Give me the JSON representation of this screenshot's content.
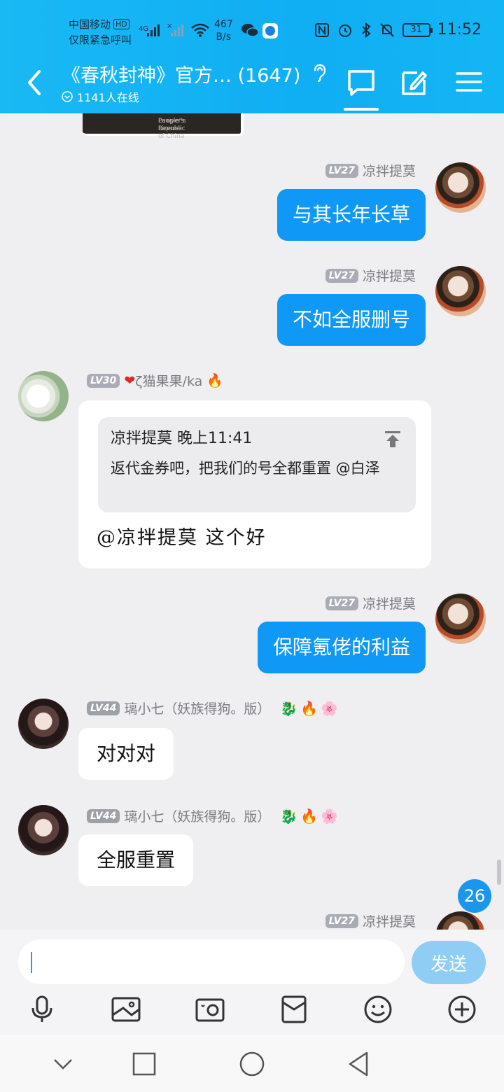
{
  "status_bar": {
    "carrier_line1": "中国移动",
    "hd_badge": "HD",
    "carrier_line2": "仅限紧急呼叫",
    "net_speed_value": "467",
    "net_speed_unit": "B/s",
    "battery": "31",
    "time": "11:52"
  },
  "header": {
    "title": "《春秋封神》官方… (1647)",
    "online_text": "1141人在线"
  },
  "shared_image_caption": {
    "line1": "Lawyer's License",
    "line2": "People's Republic of China"
  },
  "messages": [
    {
      "sender": "凉拌提莫",
      "level": "LV27",
      "text": "与其长年长草"
    },
    {
      "sender": "凉拌提莫",
      "level": "LV27",
      "text": "不如全服删号"
    },
    {
      "sender": "ζ猫果果/ka",
      "level": "LV30",
      "quote_header": "凉拌提莫 晚上11:41",
      "quote_text": "返代金券吧，把我们的号全都重置 @白泽",
      "text": "@凉拌提莫 这个好"
    },
    {
      "sender": "凉拌提莫",
      "level": "LV27",
      "text": "保障氪佬的利益"
    },
    {
      "sender": "璃小七（妖族得狗。版）",
      "level": "LV44",
      "text": "对对对"
    },
    {
      "sender": "璃小七（妖族得狗。版）",
      "level": "LV44",
      "text": "全服重置"
    },
    {
      "sender": "凉拌提莫",
      "level": "LV27"
    }
  ],
  "unread_count": "26",
  "input": {
    "placeholder": "",
    "send_label": "发送"
  },
  "icons": [
    "back-icon",
    "ear-icon",
    "chat-icon",
    "edit-icon",
    "menu-icon",
    "mic-icon",
    "picture-icon",
    "camera-icon",
    "red-packet-icon",
    "emoji-icon",
    "plus-icon",
    "nav-down-icon",
    "nav-recent-icon",
    "nav-home-icon",
    "nav-back-icon"
  ],
  "colors": {
    "header": "#13b3f4",
    "outgoing_bubble": "#0f98f6",
    "send_button": "#8fcdf5",
    "background": "#efeff2"
  }
}
